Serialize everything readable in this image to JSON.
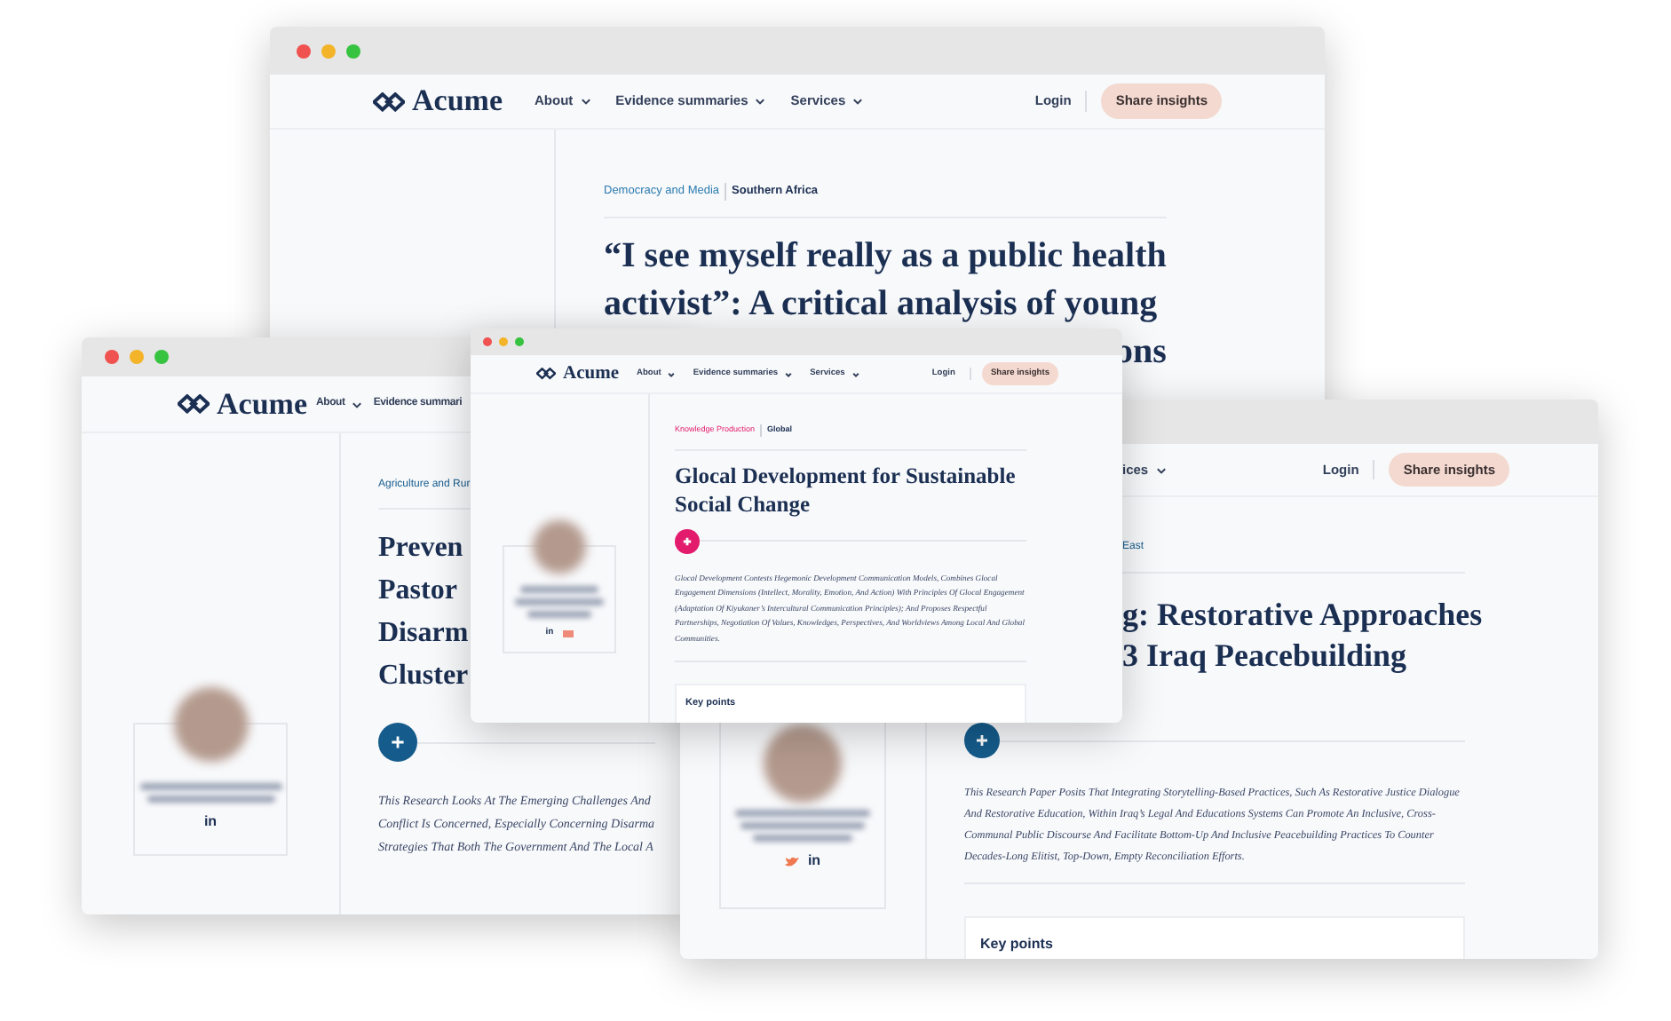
{
  "windows": [
    {
      "color": "#2b7bb0",
      "nav": {
        "logo": "Acume",
        "links": [
          {
            "label": "About",
            "dropdown": true
          },
          {
            "label": "Evidence summaries",
            "dropdown": true
          },
          {
            "label": "Services",
            "dropdown": true
          }
        ],
        "login": "Login",
        "cta": "Share insights"
      },
      "category": "Democracy and Media",
      "region": "Southern Africa",
      "title_lines": [
        "“I see myself really as a public health",
        "activist”: A critical analysis of young",
        "ons"
      ]
    },
    {
      "color": "#155c8c",
      "nav": {
        "logo": "Acume",
        "links": [
          {
            "label": "About",
            "dropdown": true
          },
          {
            "label": "Evidence summari",
            "dropdown": false
          }
        ]
      },
      "category": "Agriculture and Rur",
      "title_lines": [
        "Preven",
        "Pastor",
        "Disarm",
        "Cluster"
      ],
      "author": {
        "social_links": [
          "in"
        ]
      },
      "body_lines": [
        "This Research Looks At The Emerging Challenges And",
        "Conflict Is Concerned, Especially Concerning Disarma",
        "Strategies That Both The Government And The Local A"
      ]
    },
    {
      "color": "#e31b6d",
      "nav": {
        "logo": "Acume",
        "links": [
          {
            "label": "About",
            "dropdown": true
          },
          {
            "label": "Evidence summaries",
            "dropdown": true
          },
          {
            "label": "Services",
            "dropdown": true
          }
        ],
        "login": "Login",
        "cta": "Share insights"
      },
      "category": "Knowledge Production",
      "region": "Global",
      "title_lines": [
        "Glocal Development for Sustainable",
        "Social Change"
      ],
      "author": {
        "social_links": [
          "in"
        ]
      },
      "body": "Glocal Development Contests Hegemonic Development Communication Models, Combines Glocal Engagement Dimensions (Intellect, Morality, Emotion, And Action) With Principles Of Glocal Engagement (Adaptation Of Kiyukaner’s Intercultural Communication Principles); And Proposes Respectful Partnerships, Negotiation Of Values, Knowledges, Perspectives, And Worldviews Among Local And Global Communities.",
      "key_points": "Key points"
    },
    {
      "color": "#155c8c",
      "nav": {
        "links": [
          {
            "label": "ices",
            "dropdown": true
          }
        ],
        "login": "Login",
        "cta": "Share insights"
      },
      "category": "East",
      "title_lines": [
        "g: Restorative Approaches",
        "3 Iraq Peacebuilding"
      ],
      "author": {
        "social_links": [
          "in"
        ]
      },
      "body": "This Research Paper Posits That Integrating Storytelling-Based Practices, Such As Restorative Justice Dialogue And Restorative Education, Within Iraq’s Legal And Educations Systems Can Promote An Inclusive, Cross-Communal Public Discourse And Facilitate Bottom-Up And Inclusive Peacebuilding Practices To Counter Decades-Long Elitist, Top-Down, Empty Reconciliation Efforts.",
      "key_points": "Key points"
    }
  ]
}
